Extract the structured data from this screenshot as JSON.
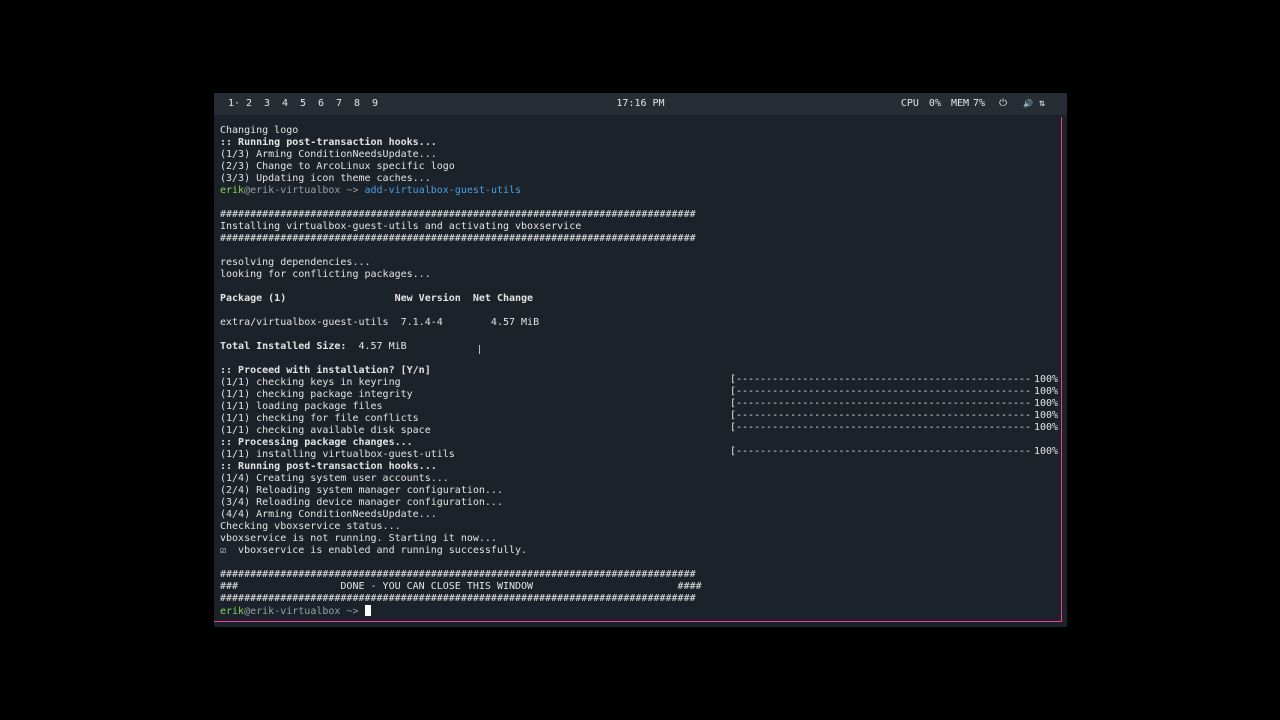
{
  "topbar": {
    "workspaces": [
      "1·",
      "2",
      "3",
      "4",
      "5",
      "6",
      "7",
      "8",
      "9"
    ],
    "clock": "17:16 PM",
    "cpu_label": "CPU",
    "cpu_value": "0%",
    "mem_label": "MEM",
    "mem_value": "7%",
    "power_icon": "⏻",
    "volume_icon": "🔊",
    "network_icon": "⇅"
  },
  "terminal": {
    "lines": [
      {
        "text": "Changing logo",
        "style": ""
      },
      {
        "text": ":: Running post-transaction hooks...",
        "style": "b"
      },
      {
        "text": "(1/3) Arming ConditionNeedsUpdate...",
        "style": ""
      },
      {
        "text": "(2/3) Change to ArcoLinux specific logo",
        "style": ""
      },
      {
        "text": "(3/3) Updating icon theme caches...",
        "style": ""
      },
      {
        "text": "",
        "style": "prompt1"
      },
      {
        "text": "",
        "style": "blank"
      },
      {
        "text": "###############################################################################",
        "style": ""
      },
      {
        "text": "Installing virtualbox-guest-utils and activating vboxservice",
        "style": ""
      },
      {
        "text": "###############################################################################",
        "style": ""
      },
      {
        "text": "",
        "style": "blank"
      },
      {
        "text": "resolving dependencies...",
        "style": ""
      },
      {
        "text": "looking for conflicting packages...",
        "style": ""
      },
      {
        "text": "",
        "style": "blank"
      },
      {
        "text": "Package (1)                  New Version  Net Change",
        "style": "b"
      },
      {
        "text": "",
        "style": "blank"
      },
      {
        "text": "extra/virtualbox-guest-utils  7.1.4-4        4.57 MiB",
        "style": ""
      },
      {
        "text": "",
        "style": "blank"
      },
      {
        "text": "Total Installed Size:  4.57 MiB",
        "style": "total"
      },
      {
        "text": "",
        "style": "blank"
      },
      {
        "text": ":: Proceed with installation? [Y/n]",
        "style": "b"
      },
      {
        "text": "(1/1) checking keys in keyring",
        "style": ""
      },
      {
        "text": "(1/1) checking package integrity",
        "style": ""
      },
      {
        "text": "(1/1) loading package files",
        "style": ""
      },
      {
        "text": "(1/1) checking for file conflicts",
        "style": ""
      },
      {
        "text": "(1/1) checking available disk space",
        "style": ""
      },
      {
        "text": ":: Processing package changes...",
        "style": "b"
      },
      {
        "text": "(1/1) installing virtualbox-guest-utils",
        "style": ""
      },
      {
        "text": ":: Running post-transaction hooks...",
        "style": "b"
      },
      {
        "text": "(1/4) Creating system user accounts...",
        "style": ""
      },
      {
        "text": "(2/4) Reloading system manager configuration...",
        "style": ""
      },
      {
        "text": "(3/4) Reloading device manager configuration...",
        "style": ""
      },
      {
        "text": "(4/4) Arming ConditionNeedsUpdate...",
        "style": ""
      },
      {
        "text": "Checking vboxservice status...",
        "style": ""
      },
      {
        "text": "vboxservice is not running. Starting it now...",
        "style": ""
      },
      {
        "text": "☑  vboxservice is enabled and running successfully.",
        "style": ""
      },
      {
        "text": "",
        "style": "blank"
      },
      {
        "text": "###############################################################################",
        "style": ""
      },
      {
        "text": "###                 DONE - YOU CAN CLOSE THIS WINDOW                        ####",
        "style": ""
      },
      {
        "text": "###############################################################################",
        "style": ""
      },
      {
        "text": "",
        "style": "prompt2"
      }
    ],
    "prompt1": {
      "user": "erik",
      "host": "@erik-virtualbox",
      "arrow": " ~> ",
      "command": "add-virtualbox-guest-utils"
    },
    "prompt2": {
      "user": "erik",
      "host": "@erik-virtualbox",
      "arrow": " ~> "
    },
    "total_label": "Total Installed Size:",
    "total_value": "  4.57 MiB"
  },
  "progress": [
    {
      "bar": "[-------------------------------------------------]",
      "percent": "100%",
      "value": 1.0
    },
    {
      "bar": "[-------------------------------------------------]",
      "percent": "100%",
      "value": 1.0
    },
    {
      "bar": "[-------------------------------------------------]",
      "percent": "100%",
      "value": 1.0
    },
    {
      "bar": "[-------------------------------------------------]",
      "percent": "100%",
      "value": 1.0
    },
    {
      "bar": "[-------------------------------------------------]",
      "percent": "100%",
      "value": 1.0
    },
    {
      "bar": "",
      "percent": "",
      "value": null
    },
    {
      "bar": "[-------------------------------------------------]",
      "percent": "100%",
      "value": 1.0
    }
  ],
  "colors": {
    "accent": "#ea3e9c",
    "prompt_user": "#8bd45a",
    "command": "#4b9fe0"
  }
}
